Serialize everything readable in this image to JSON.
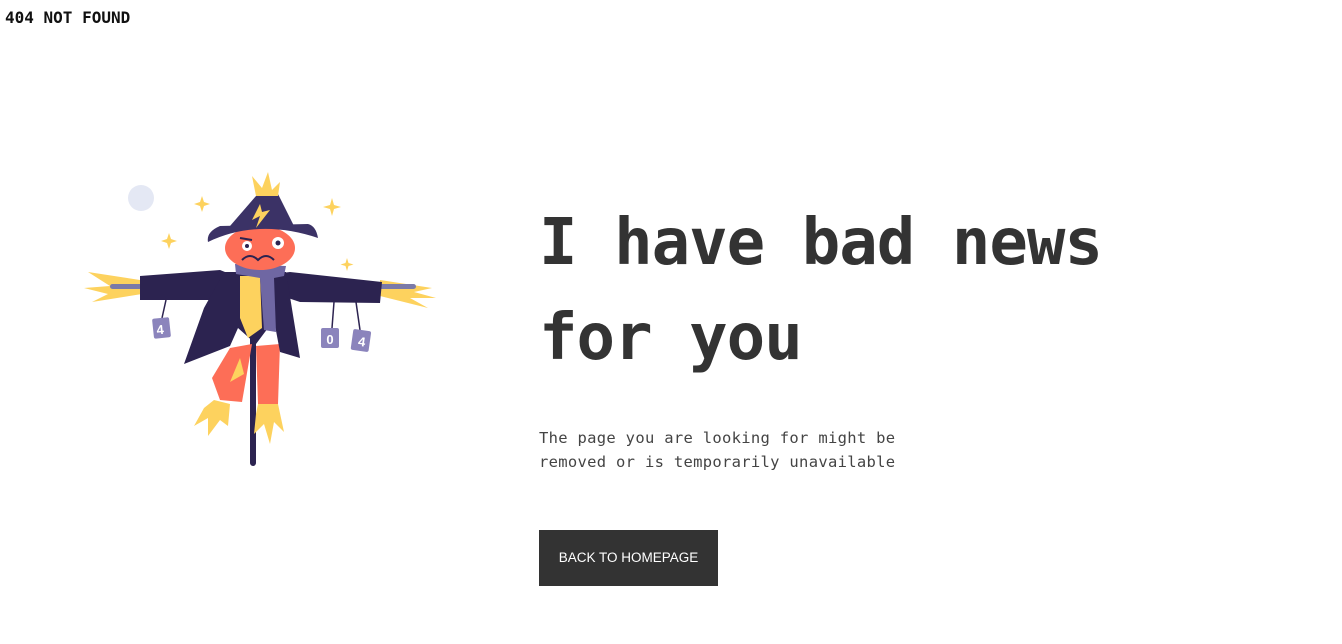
{
  "page": {
    "status_heading": "404 NOT FOUND",
    "headline_line1": "I have bad news",
    "headline_line2": "for you",
    "message_line1": "The page you are looking for might be",
    "message_line2": "removed or is temporarily unavailable",
    "button_label": "BACK TO HOMEPAGE"
  },
  "illustration": {
    "icon": "scarecrow-illustration",
    "can_labels": [
      "4",
      "0",
      "4"
    ],
    "colors": {
      "hat": "#3b3266",
      "coat": "#2c2350",
      "face": "#fd6e57",
      "straw": "#fdd25e",
      "scarf": "#6f67a3",
      "cans": "#8b84bc",
      "moon": "#e4e8f4",
      "pole": "#2c2350"
    }
  },
  "colors": {
    "text": "#333333",
    "button_bg": "#333333",
    "button_text": "#ffffff",
    "background": "#ffffff"
  }
}
